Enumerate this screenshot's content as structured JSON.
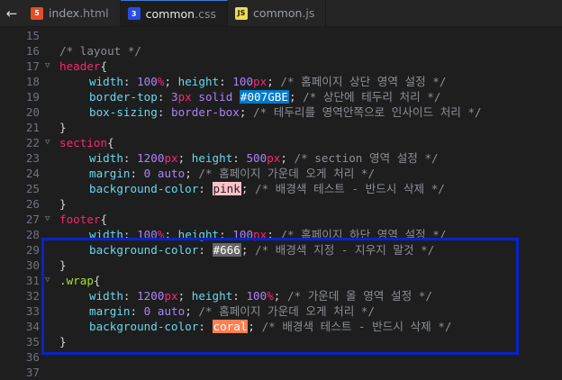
{
  "tabs": [
    {
      "name": "index",
      "ext": ".html",
      "icon": "html-file-icon",
      "type": "html",
      "active": false
    },
    {
      "name": "common",
      "ext": ".css",
      "icon": "css-file-icon",
      "type": "css",
      "active": true
    },
    {
      "name": "common",
      "ext": ".js",
      "icon": "js-file-icon",
      "type": "js",
      "active": false
    }
  ],
  "back_glyph": "←",
  "lines": [
    {
      "n": "15",
      "fold": false,
      "indent": false,
      "tokens": []
    },
    {
      "n": "16",
      "fold": false,
      "indent": false,
      "tokens": [
        {
          "t": "/* layout */",
          "c": "cmt"
        }
      ]
    },
    {
      "n": "17",
      "fold": true,
      "indent": false,
      "tokens": [
        {
          "t": "header",
          "c": "sel"
        },
        {
          "t": "{",
          "c": "punc"
        }
      ]
    },
    {
      "n": "18",
      "fold": false,
      "indent": true,
      "tokens": [
        {
          "t": "width",
          "c": "prop"
        },
        {
          "t": ": ",
          "c": "punc"
        },
        {
          "t": "100",
          "c": "num"
        },
        {
          "t": "%",
          "c": "unit"
        },
        {
          "t": "; ",
          "c": "punc"
        },
        {
          "t": "height",
          "c": "prop"
        },
        {
          "t": ": ",
          "c": "punc"
        },
        {
          "t": "100",
          "c": "num"
        },
        {
          "t": "px",
          "c": "unit"
        },
        {
          "t": "; ",
          "c": "punc"
        },
        {
          "t": "/* 홈페이지 상단 영역 설정 */",
          "c": "cmt"
        }
      ]
    },
    {
      "n": "19",
      "fold": false,
      "indent": true,
      "tokens": [
        {
          "t": "border-top",
          "c": "prop"
        },
        {
          "t": ": ",
          "c": "punc"
        },
        {
          "t": "3",
          "c": "num"
        },
        {
          "t": "px",
          "c": "unit"
        },
        {
          "t": " ",
          "c": "punc"
        },
        {
          "t": "solid",
          "c": "kw"
        },
        {
          "t": " ",
          "c": "punc"
        },
        {
          "t": "#007GBE",
          "c": "col-blue"
        },
        {
          "t": "; ",
          "c": "punc"
        },
        {
          "t": "/* 상단에 테두리 처리 */",
          "c": "cmt"
        }
      ]
    },
    {
      "n": "20",
      "fold": false,
      "indent": true,
      "tokens": [
        {
          "t": "box-sizing",
          "c": "prop"
        },
        {
          "t": ": ",
          "c": "punc"
        },
        {
          "t": "border-box",
          "c": "kw"
        },
        {
          "t": "; ",
          "c": "punc"
        },
        {
          "t": "/* 테두리를 영역안쪽으로 인사이드 처리 */",
          "c": "cmt"
        }
      ]
    },
    {
      "n": "21",
      "fold": false,
      "indent": false,
      "tokens": [
        {
          "t": "}",
          "c": "punc"
        }
      ]
    },
    {
      "n": "22",
      "fold": true,
      "indent": false,
      "tokens": [
        {
          "t": "section",
          "c": "sel"
        },
        {
          "t": "{",
          "c": "punc"
        }
      ]
    },
    {
      "n": "23",
      "fold": false,
      "indent": true,
      "tokens": [
        {
          "t": "width",
          "c": "prop"
        },
        {
          "t": ": ",
          "c": "punc"
        },
        {
          "t": "1200",
          "c": "num"
        },
        {
          "t": "px",
          "c": "unit"
        },
        {
          "t": "; ",
          "c": "punc"
        },
        {
          "t": "height",
          "c": "prop"
        },
        {
          "t": ": ",
          "c": "punc"
        },
        {
          "t": "500",
          "c": "num"
        },
        {
          "t": "px",
          "c": "unit"
        },
        {
          "t": "; ",
          "c": "punc"
        },
        {
          "t": "/* section 영역 설정 */",
          "c": "cmt"
        }
      ]
    },
    {
      "n": "24",
      "fold": false,
      "indent": true,
      "tokens": [
        {
          "t": "margin",
          "c": "prop"
        },
        {
          "t": ": ",
          "c": "punc"
        },
        {
          "t": "0",
          "c": "num"
        },
        {
          "t": " ",
          "c": "punc"
        },
        {
          "t": "auto",
          "c": "kw"
        },
        {
          "t": "; ",
          "c": "punc"
        },
        {
          "t": "/* 홈페이지 가운데 오게 처리 */",
          "c": "cmt"
        }
      ]
    },
    {
      "n": "25",
      "fold": false,
      "indent": true,
      "tokens": [
        {
          "t": "background-color",
          "c": "prop"
        },
        {
          "t": ": ",
          "c": "punc"
        },
        {
          "t": "pink",
          "c": "col-pink"
        },
        {
          "t": "; ",
          "c": "punc"
        },
        {
          "t": "/* 배경색 테스트 - 반드시 삭제 */",
          "c": "cmt"
        }
      ]
    },
    {
      "n": "26",
      "fold": false,
      "indent": false,
      "tokens": [
        {
          "t": "}",
          "c": "punc"
        }
      ]
    },
    {
      "n": "27",
      "fold": true,
      "indent": false,
      "tokens": [
        {
          "t": "footer",
          "c": "sel"
        },
        {
          "t": "{",
          "c": "punc"
        }
      ]
    },
    {
      "n": "28",
      "fold": false,
      "indent": true,
      "tokens": [
        {
          "t": "width",
          "c": "prop"
        },
        {
          "t": ": ",
          "c": "punc"
        },
        {
          "t": "100",
          "c": "num"
        },
        {
          "t": "%",
          "c": "unit"
        },
        {
          "t": "; ",
          "c": "punc"
        },
        {
          "t": "height",
          "c": "prop"
        },
        {
          "t": ": ",
          "c": "punc"
        },
        {
          "t": "100",
          "c": "num"
        },
        {
          "t": "px",
          "c": "unit"
        },
        {
          "t": "; ",
          "c": "punc"
        },
        {
          "t": "/* 홈페이지 하단 영역 설정 */",
          "c": "cmt"
        }
      ]
    },
    {
      "n": "29",
      "fold": false,
      "indent": true,
      "tokens": [
        {
          "t": "background-color",
          "c": "prop"
        },
        {
          "t": ": ",
          "c": "punc"
        },
        {
          "t": "#666",
          "c": "col-666"
        },
        {
          "t": "; ",
          "c": "punc"
        },
        {
          "t": "/* 배경색 지정 - 지우지 말것 */",
          "c": "cmt"
        }
      ]
    },
    {
      "n": "30",
      "fold": false,
      "indent": false,
      "tokens": [
        {
          "t": "}",
          "c": "punc"
        }
      ]
    },
    {
      "n": "31",
      "fold": true,
      "indent": false,
      "tokens": [
        {
          "t": ".wrap",
          "c": "sel-cls"
        },
        {
          "t": "{",
          "c": "punc"
        }
      ]
    },
    {
      "n": "32",
      "fold": false,
      "indent": true,
      "tokens": [
        {
          "t": "width",
          "c": "prop"
        },
        {
          "t": ": ",
          "c": "punc"
        },
        {
          "t": "1200",
          "c": "num"
        },
        {
          "t": "px",
          "c": "unit"
        },
        {
          "t": "; ",
          "c": "punc"
        },
        {
          "t": "height",
          "c": "prop"
        },
        {
          "t": ": ",
          "c": "punc"
        },
        {
          "t": "100",
          "c": "num"
        },
        {
          "t": "%",
          "c": "unit"
        },
        {
          "t": "; ",
          "c": "punc"
        },
        {
          "t": "/* 가운데 올 영역 설정 */",
          "c": "cmt"
        }
      ]
    },
    {
      "n": "33",
      "fold": false,
      "indent": true,
      "tokens": [
        {
          "t": "margin",
          "c": "prop"
        },
        {
          "t": ": ",
          "c": "punc"
        },
        {
          "t": "0",
          "c": "num"
        },
        {
          "t": " ",
          "c": "punc"
        },
        {
          "t": "auto",
          "c": "kw"
        },
        {
          "t": "; ",
          "c": "punc"
        },
        {
          "t": "/* 홈페이지 가운데 오게 처리 */",
          "c": "cmt"
        }
      ]
    },
    {
      "n": "34",
      "fold": false,
      "indent": true,
      "tokens": [
        {
          "t": "background-color",
          "c": "prop"
        },
        {
          "t": ": ",
          "c": "punc"
        },
        {
          "t": "coral",
          "c": "col-coral"
        },
        {
          "t": "; ",
          "c": "punc"
        },
        {
          "t": "/* 배경색 테스트 - 반드시 삭제 */",
          "c": "cmt"
        }
      ]
    },
    {
      "n": "35",
      "fold": false,
      "indent": false,
      "tokens": [
        {
          "t": "}",
          "c": "punc"
        }
      ]
    },
    {
      "n": "36",
      "fold": false,
      "indent": false,
      "tokens": []
    },
    {
      "n": "37",
      "fold": false,
      "indent": false,
      "tokens": []
    }
  ],
  "highlight_color": "#0a22c8"
}
